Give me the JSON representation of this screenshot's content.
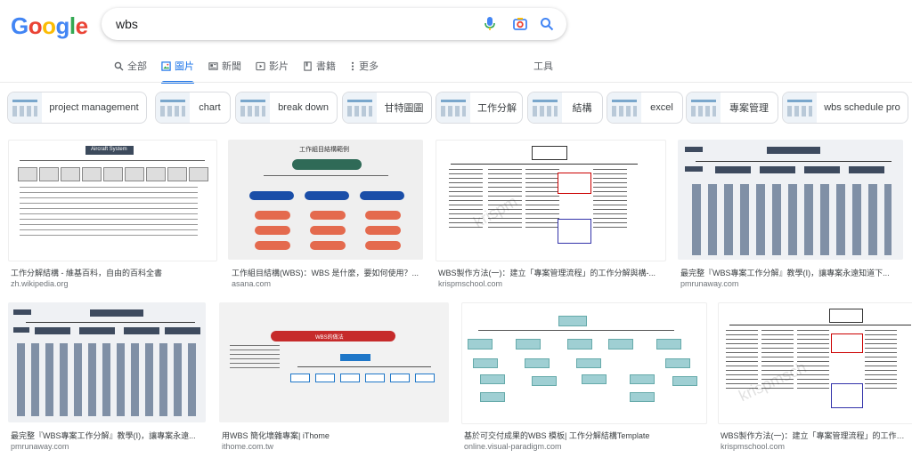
{
  "logo": {
    "letters": [
      "G",
      "o",
      "o",
      "g",
      "l",
      "e"
    ],
    "colors": [
      "#4285F4",
      "#EA4335",
      "#FBBC05",
      "#4285F4",
      "#34A853",
      "#EA4335"
    ]
  },
  "search": {
    "query": "wbs",
    "icons": [
      "mic-icon",
      "camera-icon",
      "search-icon"
    ]
  },
  "tabs": [
    {
      "label": "全部",
      "icon": "search-icon",
      "active": false
    },
    {
      "label": "圖片",
      "icon": "image-icon",
      "active": true
    },
    {
      "label": "新聞",
      "icon": "news-icon",
      "active": false
    },
    {
      "label": "影片",
      "icon": "video-icon",
      "active": false
    },
    {
      "label": "書籍",
      "icon": "book-icon",
      "active": false
    },
    {
      "label": "更多",
      "icon": "more-vert-icon",
      "active": false
    }
  ],
  "tools_label": "工具",
  "chips": [
    {
      "label": "project management"
    },
    {
      "label": "chart"
    },
    {
      "label": "break down"
    },
    {
      "label": "甘特圖圖"
    },
    {
      "label": "工作分解"
    },
    {
      "label": "結構"
    },
    {
      "label": "excel"
    },
    {
      "label": "專案管理"
    },
    {
      "label": "wbs schedule pro"
    }
  ],
  "results": [
    {
      "title": "工作分解結構 - 維基百科，自由的百科全書",
      "site": "zh.wikipedia.org",
      "img_label": "Aircraft System"
    },
    {
      "title": "工作組目結構(WBS)：WBS 是什麼，要如何使用？...",
      "site": "asana.com",
      "img_label": "工作組目結構範例"
    },
    {
      "title": "WBS製作方法(一)：建立「專案管理流程」的工作分解與構-...",
      "site": "krispmschool.com",
      "img_label": "krispm"
    },
    {
      "title": "最完整『WBS專案工作分解』教學(Ⅰ)，讓專案永遠知道下...",
      "site": "pmrunaway.com",
      "img_label": ""
    },
    {
      "title": "最完整『WBS專案工作分解』教學(Ⅰ)，讓專案永遠...",
      "site": "pmrunaway.com",
      "img_label": ""
    },
    {
      "title": "用WBS 簡化壞雜專案| iThome",
      "site": "ithome.com.tw",
      "img_label": "WBS的做法"
    },
    {
      "title": "基於可交付成果的WBS 模板| 工作分解結構Template",
      "site": "online.visual-paradigm.com",
      "img_label": ""
    },
    {
      "title": "WBS製作方法(一)：建立「專案管理流程」的工作分解...",
      "site": "krispmschool.com",
      "img_label": "krispmsch"
    }
  ]
}
